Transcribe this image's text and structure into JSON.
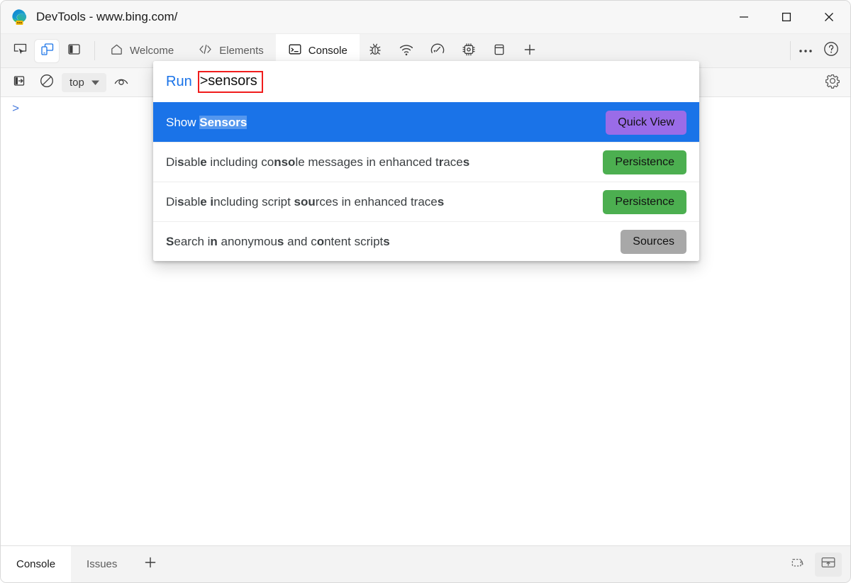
{
  "window": {
    "title": "DevTools - www.bing.com/",
    "logo_icon": "edge-devtools-logo",
    "controls": {
      "minimize": "minimize-icon",
      "maximize": "maximize-icon",
      "close": "close-icon"
    }
  },
  "tabstrip": {
    "device_buttons": [
      {
        "name": "inspect-element-icon",
        "label": "Inspect"
      },
      {
        "name": "device-emulation-icon",
        "label": "Toggle device emulation"
      },
      {
        "name": "sidebar-panel-icon",
        "label": "Toggle panel"
      }
    ],
    "tabs": [
      {
        "label": "Welcome",
        "icon": "home-icon",
        "selected": false
      },
      {
        "label": "Elements",
        "icon": "code-brackets-icon",
        "selected": false
      },
      {
        "label": "Console",
        "icon": "console-prompt-icon",
        "selected": true
      },
      {
        "label": "Sources",
        "icon": "bug-icon",
        "selected": false,
        "icon_only": true
      },
      {
        "label": "Network",
        "icon": "wifi-icon",
        "selected": false,
        "icon_only": true
      },
      {
        "label": "Performance",
        "icon": "gauge-icon",
        "selected": false,
        "icon_only": true
      },
      {
        "label": "Memory",
        "icon": "chip-icon",
        "selected": false,
        "icon_only": true
      },
      {
        "label": "Application",
        "icon": "application-panel-icon",
        "selected": false,
        "icon_only": true
      },
      {
        "label": "More tools",
        "icon": "plus-icon",
        "selected": false,
        "icon_only": true
      }
    ],
    "right_buttons": [
      {
        "name": "more-options-icon",
        "label": "Customize and control DevTools"
      },
      {
        "name": "help-icon",
        "label": "Help"
      }
    ]
  },
  "console_toolbar": {
    "sidebar_toggle_icon": "console-sidebar-icon",
    "clear_console_icon": "clear-console-icon",
    "context_value": "top",
    "context_chevron_icon": "chevron-down-icon",
    "live_expression_icon": "eye-icon",
    "settings_icon": "gear-icon"
  },
  "console_body": {
    "prompt_chevron": ">"
  },
  "palette": {
    "run_label": "Run",
    "query_prefix": ">",
    "query_value": "sensors",
    "query_full": ">sensors",
    "items": [
      {
        "title": "Show Sensors",
        "title_parts": [
          {
            "text": "Show ",
            "bold": false
          },
          {
            "text": "Sensors",
            "bold": true
          }
        ],
        "badge": "Quick View",
        "badge_style": "quickview",
        "selected": true
      },
      {
        "title": "Disable including console messages in enhanced traces",
        "title_parts": [
          {
            "text": "Di",
            "bold": false
          },
          {
            "text": "s",
            "bold": true
          },
          {
            "text": "abl",
            "bold": false
          },
          {
            "text": "e",
            "bold": true
          },
          {
            "text": " including co",
            "bold": false
          },
          {
            "text": "nso",
            "bold": true
          },
          {
            "text": "le messages in enhanced t",
            "bold": false
          },
          {
            "text": "r",
            "bold": true
          },
          {
            "text": "ace",
            "bold": false
          },
          {
            "text": "s",
            "bold": true
          }
        ],
        "badge": "Persistence",
        "badge_style": "persistence",
        "selected": false
      },
      {
        "title": "Disable including script sources in enhanced traces",
        "title_parts": [
          {
            "text": "Di",
            "bold": false
          },
          {
            "text": "s",
            "bold": true
          },
          {
            "text": "abl",
            "bold": false
          },
          {
            "text": "e i",
            "bold": true
          },
          {
            "text": "ncluding script ",
            "bold": false
          },
          {
            "text": "sou",
            "bold": true
          },
          {
            "text": "rces in enhanced trace",
            "bold": false
          },
          {
            "text": "s",
            "bold": true
          }
        ],
        "badge": "Persistence",
        "badge_style": "persistence",
        "selected": false
      },
      {
        "title": "Search in anonymous and content scripts",
        "title_parts": [
          {
            "text": "S",
            "bold": true
          },
          {
            "text": "e",
            "bold": false
          },
          {
            "text": "a",
            "bold": false
          },
          {
            "text": "rch i",
            "bold": false
          },
          {
            "text": "n",
            "bold": true
          },
          {
            "text": " anonymou",
            "bold": false
          },
          {
            "text": "s",
            "bold": true
          },
          {
            "text": " and c",
            "bold": false
          },
          {
            "text": "o",
            "bold": true
          },
          {
            "text": "ntent script",
            "bold": false
          },
          {
            "text": "s",
            "bold": true
          }
        ],
        "badge": "Sources",
        "badge_style": "sources",
        "selected": false
      }
    ]
  },
  "drawer": {
    "tabs": [
      {
        "label": "Console",
        "selected": true
      },
      {
        "label": "Issues",
        "selected": false
      }
    ],
    "add_tool_icon": "plus-icon",
    "right_buttons": [
      {
        "name": "restore-drawer-icon",
        "label": "Restore drawer"
      },
      {
        "name": "dock-to-top-icon",
        "label": "Dock to top"
      }
    ]
  },
  "colors": {
    "selection_blue": "#1a73e8",
    "highlight_red": "#f01c1c",
    "badge_quickview": "#9a6ce8",
    "badge_persistence": "#4caf50",
    "badge_sources": "#a8a8a8",
    "run_label_blue": "#1a73e8"
  }
}
